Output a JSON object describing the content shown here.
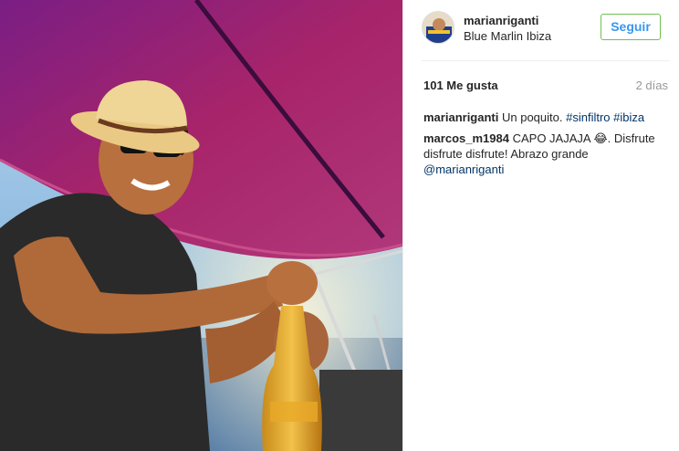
{
  "post": {
    "username": "marianriganti",
    "location": "Blue Marlin Ibiza",
    "follow_label": "Seguir",
    "likes": "101 Me gusta",
    "time": "2 días"
  },
  "comments": [
    {
      "user": "marianriganti",
      "text": "Un poquito.",
      "hashtags": [
        "#sinfiltro",
        "#ibiza"
      ]
    },
    {
      "user": "marcos_m1984",
      "text": "CAPO JAJAJA 😂. Disfrute disfrute disfrute! Abrazo grande",
      "mention": "@marianriganti"
    }
  ],
  "colors": {
    "accent": "#3897f0",
    "link": "#003569",
    "follow_border": "#70c050",
    "muted": "#999999"
  },
  "icons": {
    "avatar": "avatar-photo"
  }
}
